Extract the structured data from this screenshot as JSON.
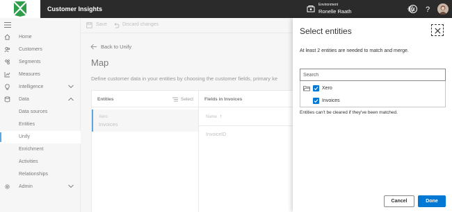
{
  "header": {
    "app_title": "Customer Insights",
    "environment_label": "Environment",
    "environment_name": "Ronelle Raath",
    "icons": [
      "environment-icon",
      "smiley-icon",
      "gear-icon",
      "help-icon",
      "avatar"
    ]
  },
  "nav": {
    "items": [
      {
        "label": "Home",
        "icon": "home-icon"
      },
      {
        "label": "Customers",
        "icon": "people-icon"
      },
      {
        "label": "Segments",
        "icon": "segments-icon"
      },
      {
        "label": "Measures",
        "icon": "chart-icon"
      },
      {
        "label": "Intelligence",
        "icon": "lightbulb-icon"
      },
      {
        "label": "Data",
        "icon": "database-icon"
      },
      {
        "label": "Data sources"
      },
      {
        "label": "Entities"
      },
      {
        "label": "Unify"
      },
      {
        "label": "Enrichment"
      },
      {
        "label": "Activities"
      },
      {
        "label": "Relationships"
      },
      {
        "label": "Admin",
        "icon": "gear-icon"
      }
    ],
    "selected": "Unify"
  },
  "commandbar": {
    "save_label": "Save",
    "discard_label": "Discard changes"
  },
  "main": {
    "back_label": "Back to Unify",
    "page_title": "Map",
    "description": "Define customer data in your entities by choosing the customer fields, primary ke",
    "entities_header": "Entities",
    "select_label": "Select",
    "entity_source": "Xero",
    "entity_name": "Invoices",
    "fields_header": "Fields in Invoices",
    "name_column": "Name",
    "sort_arrow": "↑",
    "field_value": "InvoiceID"
  },
  "panel": {
    "title": "Select entities",
    "hint": "At least 2 entities are needed to match and merge.",
    "search_placeholder": "Search",
    "tree": {
      "folder_label": "Xero",
      "child_label": "Invoices"
    },
    "note": "Entities can't be cleared if they've been matched.",
    "cancel_label": "Cancel",
    "done_label": "Done"
  },
  "colors": {
    "accent": "#0078d4",
    "header_bg": "#2b2b2b",
    "logo_green": "#2e9e4a"
  }
}
